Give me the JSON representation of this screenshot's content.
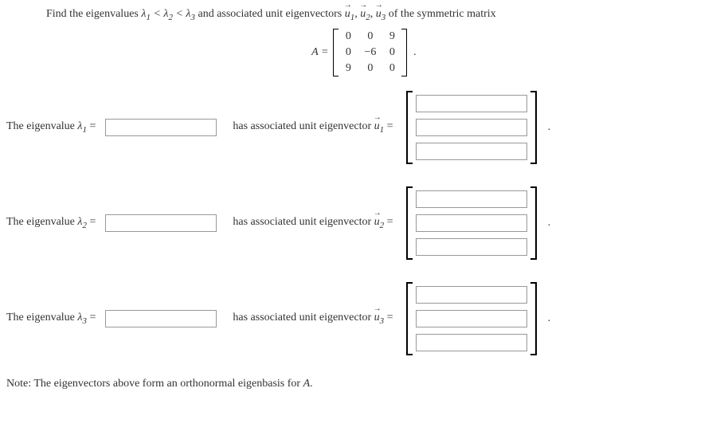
{
  "problem": {
    "intro_prefix": "Find the eigenvalues ",
    "lambda_order": "λ₁ < λ₂ < λ₃",
    "intro_mid": " and associated unit eigenvectors ",
    "vectors_list": "u⃗₁, u⃗₂, u⃗₃",
    "intro_suffix": " of the symmetric matrix"
  },
  "matrix": {
    "label": "A =",
    "rows": [
      [
        "0",
        "0",
        "9"
      ],
      [
        "0",
        "−6",
        "0"
      ],
      [
        "9",
        "0",
        "0"
      ]
    ],
    "trailing_dot": "."
  },
  "rows": [
    {
      "label_prefix": "The eigenvalue ",
      "lambda": "λ",
      "sub": "1",
      "equals": " = ",
      "eigenvalue_value": "",
      "unit_label_prefix": "has associated unit eigenvector ",
      "u": "u",
      "u_sub": "1",
      "u_equals": " = ",
      "vector_values": [
        "",
        "",
        ""
      ],
      "trailing_dot": "."
    },
    {
      "label_prefix": "The eigenvalue ",
      "lambda": "λ",
      "sub": "2",
      "equals": " = ",
      "eigenvalue_value": "",
      "unit_label_prefix": "has associated unit eigenvector ",
      "u": "u",
      "u_sub": "2",
      "u_equals": " = ",
      "vector_values": [
        "",
        "",
        ""
      ],
      "trailing_dot": "."
    },
    {
      "label_prefix": "The eigenvalue ",
      "lambda": "λ",
      "sub": "3",
      "equals": " = ",
      "eigenvalue_value": "",
      "unit_label_prefix": "has associated unit eigenvector ",
      "u": "u",
      "u_sub": "3",
      "u_equals": " = ",
      "vector_values": [
        "",
        "",
        ""
      ],
      "trailing_dot": "."
    }
  ],
  "note": {
    "prefix": "Note: The eigenvectors above form an orthonormal eigenbasis for ",
    "A": "A",
    "suffix": "."
  }
}
